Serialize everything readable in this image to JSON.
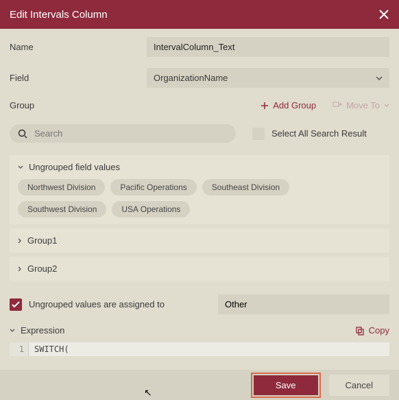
{
  "titlebar": {
    "title": "Edit Intervals Column"
  },
  "form": {
    "name_label": "Name",
    "name_value": "IntervalColumn_Text",
    "field_label": "Field",
    "field_value": "OrganizationName",
    "group_label": "Group",
    "add_group": "Add Group",
    "move_to": "Move To"
  },
  "search": {
    "placeholder": "Search",
    "select_all": "Select All Search Result"
  },
  "ungrouped": {
    "title": "Ungrouped field values",
    "values": [
      "Northwest Division",
      "Pacific Operations",
      "Southeast Division",
      "Southwest Division",
      "USA Operations"
    ]
  },
  "groups": [
    {
      "name": "Group1"
    },
    {
      "name": "Group2"
    }
  ],
  "assigned": {
    "label": "Ungrouped values are assigned to",
    "value": "Other"
  },
  "expression": {
    "label": "Expression",
    "copy": "Copy",
    "lines": [
      "SWITCH("
    ]
  },
  "footer": {
    "save": "Save",
    "cancel": "Cancel"
  }
}
